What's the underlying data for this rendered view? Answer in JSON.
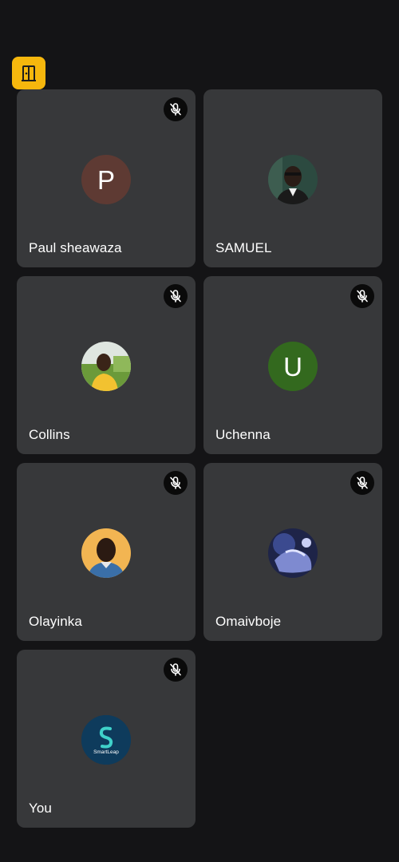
{
  "toolbar": {
    "exit_icon": "door-exit-icon",
    "exit_color": "#f6b70d"
  },
  "colors": {
    "background": "#141416",
    "tile": "#37383a",
    "mute_bg": "#0a0a0a",
    "avatar_brown": "#5e3a33",
    "avatar_green": "#33691e",
    "avatar_navy": "#0e3b5c"
  },
  "participants": [
    {
      "name": "Paul sheawaza",
      "avatar_initial": "P",
      "avatar_type": "initial",
      "muted": true
    },
    {
      "name": "SAMUEL",
      "avatar_type": "photo",
      "muted": false
    },
    {
      "name": "Collins",
      "avatar_type": "photo",
      "muted": true
    },
    {
      "name": "Uchenna",
      "avatar_initial": "U",
      "avatar_type": "initial",
      "muted": true
    },
    {
      "name": "Olayinka",
      "avatar_type": "photo",
      "muted": true
    },
    {
      "name": "Omaivboje",
      "avatar_type": "photo",
      "muted": true
    },
    {
      "name": "You",
      "avatar_type": "logo",
      "avatar_logo_text": "SmartLeap",
      "muted": true
    }
  ]
}
